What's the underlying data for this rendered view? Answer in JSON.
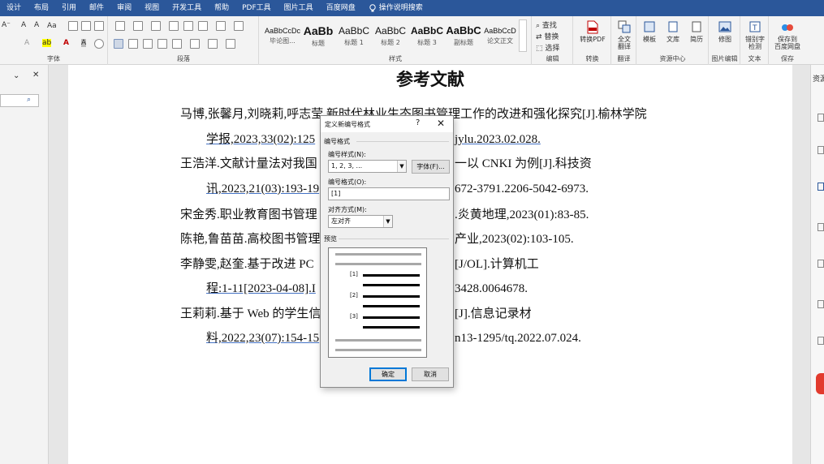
{
  "menubar": {
    "tabs": [
      "设计",
      "布局",
      "引用",
      "邮件",
      "审阅",
      "视图",
      "开发工具",
      "帮助",
      "PDF工具",
      "图片工具",
      "百度网盘"
    ],
    "tell_me": "操作说明搜索"
  },
  "ribbon": {
    "font_group_label": "字体",
    "paragraph_group_label": "段落",
    "styles_group_label": "样式",
    "editing_group_label": "编辑",
    "convert_group_label": "转换",
    "translate_group_label": "翻译",
    "resource_group_label": "资源中心",
    "image_edit_group_label": "图片编辑",
    "text_group_label": "文本",
    "save_group_label": "保存",
    "styles": [
      {
        "preview": "AaBbCcDc",
        "name": "毕论图..."
      },
      {
        "preview": "AaBb",
        "name": "标题"
      },
      {
        "preview": "AaBbC",
        "name": "标题 1"
      },
      {
        "preview": "AaBbC",
        "name": "标题 2"
      },
      {
        "preview": "AaBbC",
        "name": "标题 3"
      },
      {
        "preview": "AaBbC",
        "name": "副标题"
      },
      {
        "preview": "AaBbCcD",
        "name": "论文正文"
      }
    ],
    "find_label": "查找",
    "replace_label": "替换",
    "select_label": "选择",
    "to_pdf_label": "转换PDF",
    "full_translate_label": "全文\n翻译",
    "template_label": "模板",
    "library_label": "文库",
    "resume_label": "简历",
    "retouch_label": "修图",
    "ocr_label": "错别字\n检测",
    "save_baidu_label": "保存到\n百度网盘",
    "font_size_value": "Aa"
  },
  "document": {
    "title": "参考文献",
    "lines": [
      "马博,张馨月,刘晓莉,呼志莹.新时代林业生态图书管理工作的改进和强化探究[J].榆林学院",
      "学报,2023,33(02):125",
      "jylu.2023.02.028.",
      "王浩洋.文献计量法对我国",
      "一以 CNKI 为例[J].科技资",
      "讯,2023,21(03):193-19",
      "672-3791.2206-5042-6973.",
      "宋金秀.职业教育图书管理",
      ".炎黄地理,2023(01):83-85.",
      "陈艳,鲁苗苗.高校图书管理",
      "产业,2023(02):103-105.",
      "李静雯,赵奎.基于改进 PC",
      "[J/OL].计算机工",
      "程:1-11[2023-04-08].I",
      "3428.0064678.",
      "王莉莉.基于 Web 的学生信",
      "[J].信息记录材",
      "料,2022,23(07):154-15",
      "n13-1295/tq.2022.07.024."
    ]
  },
  "rightpane": {
    "label": "资源"
  },
  "dialog": {
    "title": "定义新编号格式",
    "help": "?",
    "close": "✕",
    "section_number_format": "编号格式",
    "number_style_label": "编号样式(N):",
    "number_style_value": "1, 2, 3, ...",
    "font_button": "字体(F)...",
    "number_format_label": "编号格式(O):",
    "number_format_value": "[1]",
    "alignment_label": "对齐方式(M):",
    "alignment_value": "左对齐",
    "preview_label": "预览",
    "preview_numbers": [
      "[1]",
      "[2]",
      "[3]"
    ],
    "ok_button": "确定",
    "cancel_button": "取消"
  },
  "colors": {
    "menubar": "#2b579a",
    "ribbon": "#f3f3f3",
    "accent": "#0078d7"
  }
}
